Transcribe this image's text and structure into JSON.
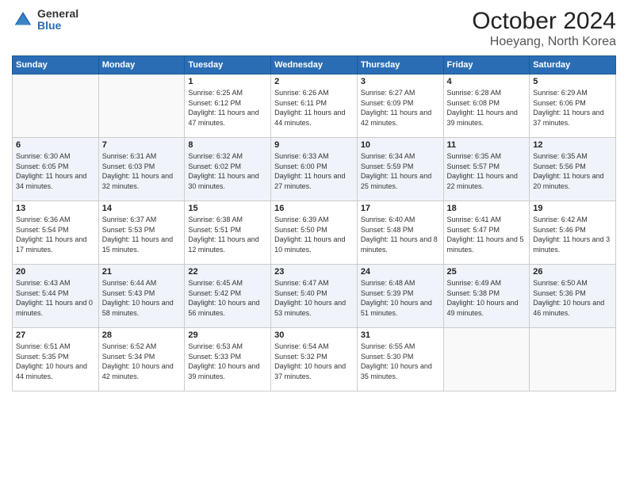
{
  "header": {
    "logo_general": "General",
    "logo_blue": "Blue",
    "month": "October 2024",
    "location": "Hoeyang, North Korea"
  },
  "days_of_week": [
    "Sunday",
    "Monday",
    "Tuesday",
    "Wednesday",
    "Thursday",
    "Friday",
    "Saturday"
  ],
  "weeks": [
    [
      {
        "day": "",
        "sunrise": "",
        "sunset": "",
        "daylight": ""
      },
      {
        "day": "",
        "sunrise": "",
        "sunset": "",
        "daylight": ""
      },
      {
        "day": "1",
        "sunrise": "Sunrise: 6:25 AM",
        "sunset": "Sunset: 6:12 PM",
        "daylight": "Daylight: 11 hours and 47 minutes."
      },
      {
        "day": "2",
        "sunrise": "Sunrise: 6:26 AM",
        "sunset": "Sunset: 6:11 PM",
        "daylight": "Daylight: 11 hours and 44 minutes."
      },
      {
        "day": "3",
        "sunrise": "Sunrise: 6:27 AM",
        "sunset": "Sunset: 6:09 PM",
        "daylight": "Daylight: 11 hours and 42 minutes."
      },
      {
        "day": "4",
        "sunrise": "Sunrise: 6:28 AM",
        "sunset": "Sunset: 6:08 PM",
        "daylight": "Daylight: 11 hours and 39 minutes."
      },
      {
        "day": "5",
        "sunrise": "Sunrise: 6:29 AM",
        "sunset": "Sunset: 6:06 PM",
        "daylight": "Daylight: 11 hours and 37 minutes."
      }
    ],
    [
      {
        "day": "6",
        "sunrise": "Sunrise: 6:30 AM",
        "sunset": "Sunset: 6:05 PM",
        "daylight": "Daylight: 11 hours and 34 minutes."
      },
      {
        "day": "7",
        "sunrise": "Sunrise: 6:31 AM",
        "sunset": "Sunset: 6:03 PM",
        "daylight": "Daylight: 11 hours and 32 minutes."
      },
      {
        "day": "8",
        "sunrise": "Sunrise: 6:32 AM",
        "sunset": "Sunset: 6:02 PM",
        "daylight": "Daylight: 11 hours and 30 minutes."
      },
      {
        "day": "9",
        "sunrise": "Sunrise: 6:33 AM",
        "sunset": "Sunset: 6:00 PM",
        "daylight": "Daylight: 11 hours and 27 minutes."
      },
      {
        "day": "10",
        "sunrise": "Sunrise: 6:34 AM",
        "sunset": "Sunset: 5:59 PM",
        "daylight": "Daylight: 11 hours and 25 minutes."
      },
      {
        "day": "11",
        "sunrise": "Sunrise: 6:35 AM",
        "sunset": "Sunset: 5:57 PM",
        "daylight": "Daylight: 11 hours and 22 minutes."
      },
      {
        "day": "12",
        "sunrise": "Sunrise: 6:35 AM",
        "sunset": "Sunset: 5:56 PM",
        "daylight": "Daylight: 11 hours and 20 minutes."
      }
    ],
    [
      {
        "day": "13",
        "sunrise": "Sunrise: 6:36 AM",
        "sunset": "Sunset: 5:54 PM",
        "daylight": "Daylight: 11 hours and 17 minutes."
      },
      {
        "day": "14",
        "sunrise": "Sunrise: 6:37 AM",
        "sunset": "Sunset: 5:53 PM",
        "daylight": "Daylight: 11 hours and 15 minutes."
      },
      {
        "day": "15",
        "sunrise": "Sunrise: 6:38 AM",
        "sunset": "Sunset: 5:51 PM",
        "daylight": "Daylight: 11 hours and 12 minutes."
      },
      {
        "day": "16",
        "sunrise": "Sunrise: 6:39 AM",
        "sunset": "Sunset: 5:50 PM",
        "daylight": "Daylight: 11 hours and 10 minutes."
      },
      {
        "day": "17",
        "sunrise": "Sunrise: 6:40 AM",
        "sunset": "Sunset: 5:48 PM",
        "daylight": "Daylight: 11 hours and 8 minutes."
      },
      {
        "day": "18",
        "sunrise": "Sunrise: 6:41 AM",
        "sunset": "Sunset: 5:47 PM",
        "daylight": "Daylight: 11 hours and 5 minutes."
      },
      {
        "day": "19",
        "sunrise": "Sunrise: 6:42 AM",
        "sunset": "Sunset: 5:46 PM",
        "daylight": "Daylight: 11 hours and 3 minutes."
      }
    ],
    [
      {
        "day": "20",
        "sunrise": "Sunrise: 6:43 AM",
        "sunset": "Sunset: 5:44 PM",
        "daylight": "Daylight: 11 hours and 0 minutes."
      },
      {
        "day": "21",
        "sunrise": "Sunrise: 6:44 AM",
        "sunset": "Sunset: 5:43 PM",
        "daylight": "Daylight: 10 hours and 58 minutes."
      },
      {
        "day": "22",
        "sunrise": "Sunrise: 6:45 AM",
        "sunset": "Sunset: 5:42 PM",
        "daylight": "Daylight: 10 hours and 56 minutes."
      },
      {
        "day": "23",
        "sunrise": "Sunrise: 6:47 AM",
        "sunset": "Sunset: 5:40 PM",
        "daylight": "Daylight: 10 hours and 53 minutes."
      },
      {
        "day": "24",
        "sunrise": "Sunrise: 6:48 AM",
        "sunset": "Sunset: 5:39 PM",
        "daylight": "Daylight: 10 hours and 51 minutes."
      },
      {
        "day": "25",
        "sunrise": "Sunrise: 6:49 AM",
        "sunset": "Sunset: 5:38 PM",
        "daylight": "Daylight: 10 hours and 49 minutes."
      },
      {
        "day": "26",
        "sunrise": "Sunrise: 6:50 AM",
        "sunset": "Sunset: 5:36 PM",
        "daylight": "Daylight: 10 hours and 46 minutes."
      }
    ],
    [
      {
        "day": "27",
        "sunrise": "Sunrise: 6:51 AM",
        "sunset": "Sunset: 5:35 PM",
        "daylight": "Daylight: 10 hours and 44 minutes."
      },
      {
        "day": "28",
        "sunrise": "Sunrise: 6:52 AM",
        "sunset": "Sunset: 5:34 PM",
        "daylight": "Daylight: 10 hours and 42 minutes."
      },
      {
        "day": "29",
        "sunrise": "Sunrise: 6:53 AM",
        "sunset": "Sunset: 5:33 PM",
        "daylight": "Daylight: 10 hours and 39 minutes."
      },
      {
        "day": "30",
        "sunrise": "Sunrise: 6:54 AM",
        "sunset": "Sunset: 5:32 PM",
        "daylight": "Daylight: 10 hours and 37 minutes."
      },
      {
        "day": "31",
        "sunrise": "Sunrise: 6:55 AM",
        "sunset": "Sunset: 5:30 PM",
        "daylight": "Daylight: 10 hours and 35 minutes."
      },
      {
        "day": "",
        "sunrise": "",
        "sunset": "",
        "daylight": ""
      },
      {
        "day": "",
        "sunrise": "",
        "sunset": "",
        "daylight": ""
      }
    ]
  ]
}
